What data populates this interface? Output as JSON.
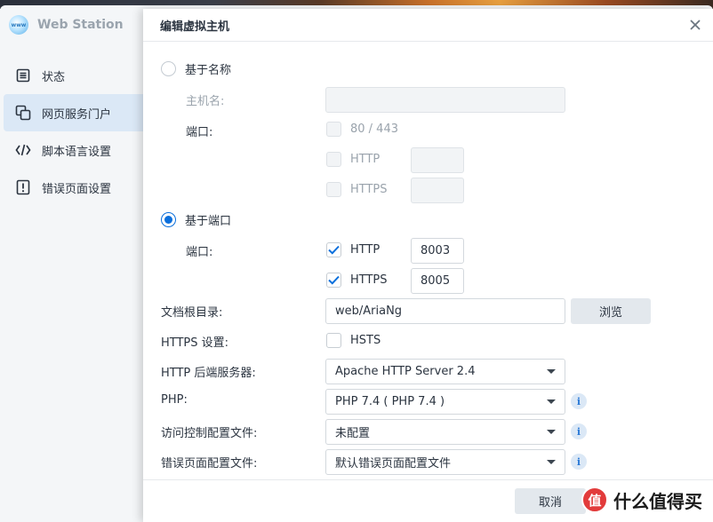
{
  "app": {
    "title": "Web Station",
    "logo_text": "www",
    "sidebar": [
      {
        "label": "状态",
        "icon": "status-icon",
        "active": false
      },
      {
        "label": "网页服务门户",
        "icon": "portal-icon",
        "active": true
      },
      {
        "label": "脚本语言设置",
        "icon": "code-icon",
        "active": false
      },
      {
        "label": "错误页面设置",
        "icon": "error-page-icon",
        "active": false
      }
    ]
  },
  "dialog": {
    "title": "编辑虚拟主机",
    "by_name": {
      "radio_label": "基于名称",
      "selected": false,
      "hostname_label": "主机名:",
      "hostname_value": "",
      "port_label": "端口:",
      "port_80_443_label": "80 / 443",
      "http_label": "HTTP",
      "https_label": "HTTPS",
      "http_value": "",
      "https_value": ""
    },
    "by_port": {
      "radio_label": "基于端口",
      "selected": true,
      "port_label": "端口:",
      "http_label": "HTTP",
      "http_checked": true,
      "http_value": "8003",
      "https_label": "HTTPS",
      "https_checked": true,
      "https_value": "8005"
    },
    "doc_root": {
      "label": "文档根目录:",
      "value": "web/AriaNg",
      "browse_label": "浏览"
    },
    "https_settings": {
      "label": "HTTPS 设置:",
      "hsts_label": "HSTS",
      "hsts_checked": false
    },
    "backend": {
      "label": "HTTP 后端服务器:",
      "value": "Apache HTTP Server 2.4"
    },
    "php": {
      "label": "PHP:",
      "value": "PHP 7.4 ( PHP 7.4 )"
    },
    "access_control": {
      "label": "访问控制配置文件:",
      "value": "未配置"
    },
    "error_page": {
      "label": "错误页面配置文件:",
      "value": "默认错误页面配置文件"
    },
    "footer": {
      "cancel_label": "取消"
    }
  },
  "watermark": {
    "text": "什么值得买",
    "badge": "值"
  },
  "colors": {
    "accent": "#0a6fdc",
    "sidebar_active": "#dbe8f6",
    "button_gray": "#e3e8ed"
  }
}
